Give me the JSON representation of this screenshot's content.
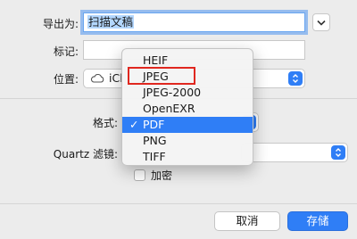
{
  "form": {
    "export_as_label": "导出为:",
    "export_as_value": "扫描文稿",
    "tags_label": "标记:",
    "location_label": "位置:",
    "location_value": "iCl",
    "format_label": "格式:",
    "quartz_label": "Quartz 滤镜:",
    "encrypt_label": "加密"
  },
  "format_menu": {
    "items": [
      "HEIF",
      "JPEG",
      "JPEG-2000",
      "OpenEXR",
      "PDF",
      "PNG",
      "TIFF"
    ],
    "selected": "PDF",
    "check_glyph": "✓",
    "highlighted": "JPEG",
    "highlight_color": "#e0271f"
  },
  "footer": {
    "cancel_label": "取消",
    "save_label": "存储"
  },
  "colors": {
    "accent": "#2f7ef6",
    "selection": "#b3d7ff"
  },
  "icons": {
    "location": "cloud-icon",
    "expand": "chevron-down-icon",
    "stepper": "up-down-chevron-icon"
  }
}
